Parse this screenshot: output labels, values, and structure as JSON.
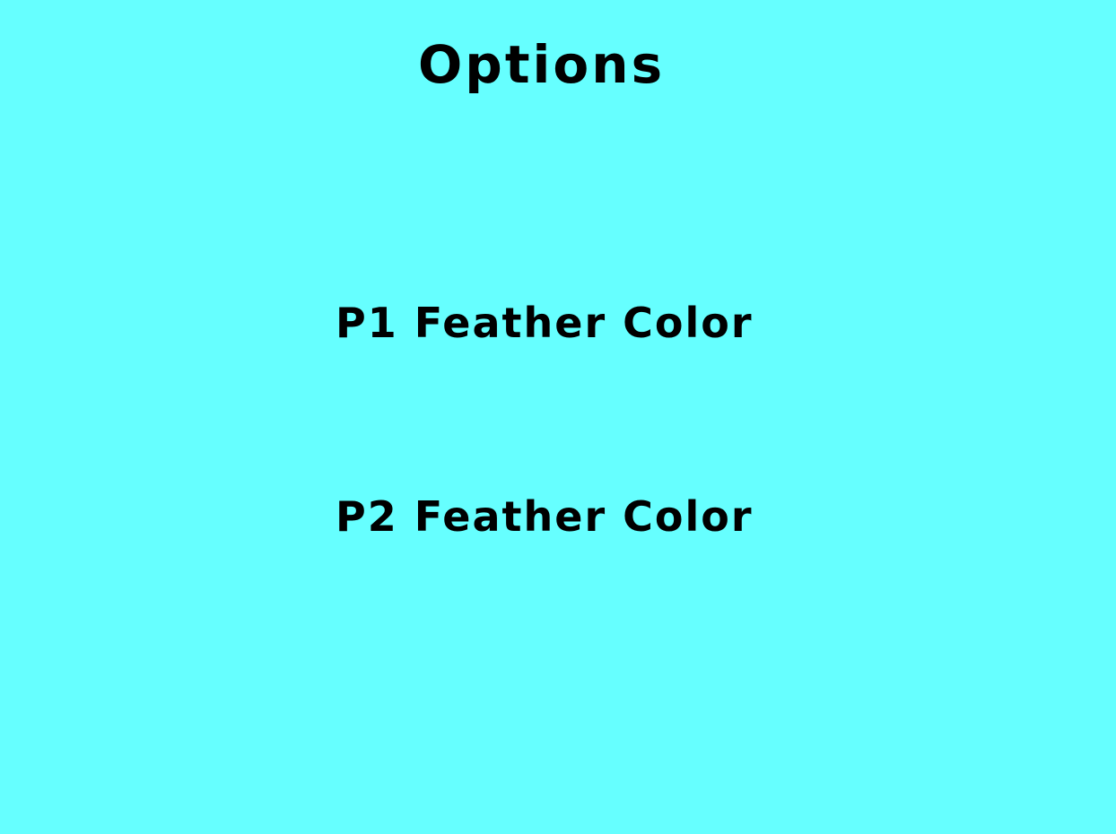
{
  "screen": {
    "title": "Options",
    "background_color": "#66FFFF",
    "text_color": "#000000"
  },
  "menu": {
    "items": [
      {
        "label": "P1 Feather Color"
      },
      {
        "label": "P2 Feather Color"
      }
    ]
  }
}
